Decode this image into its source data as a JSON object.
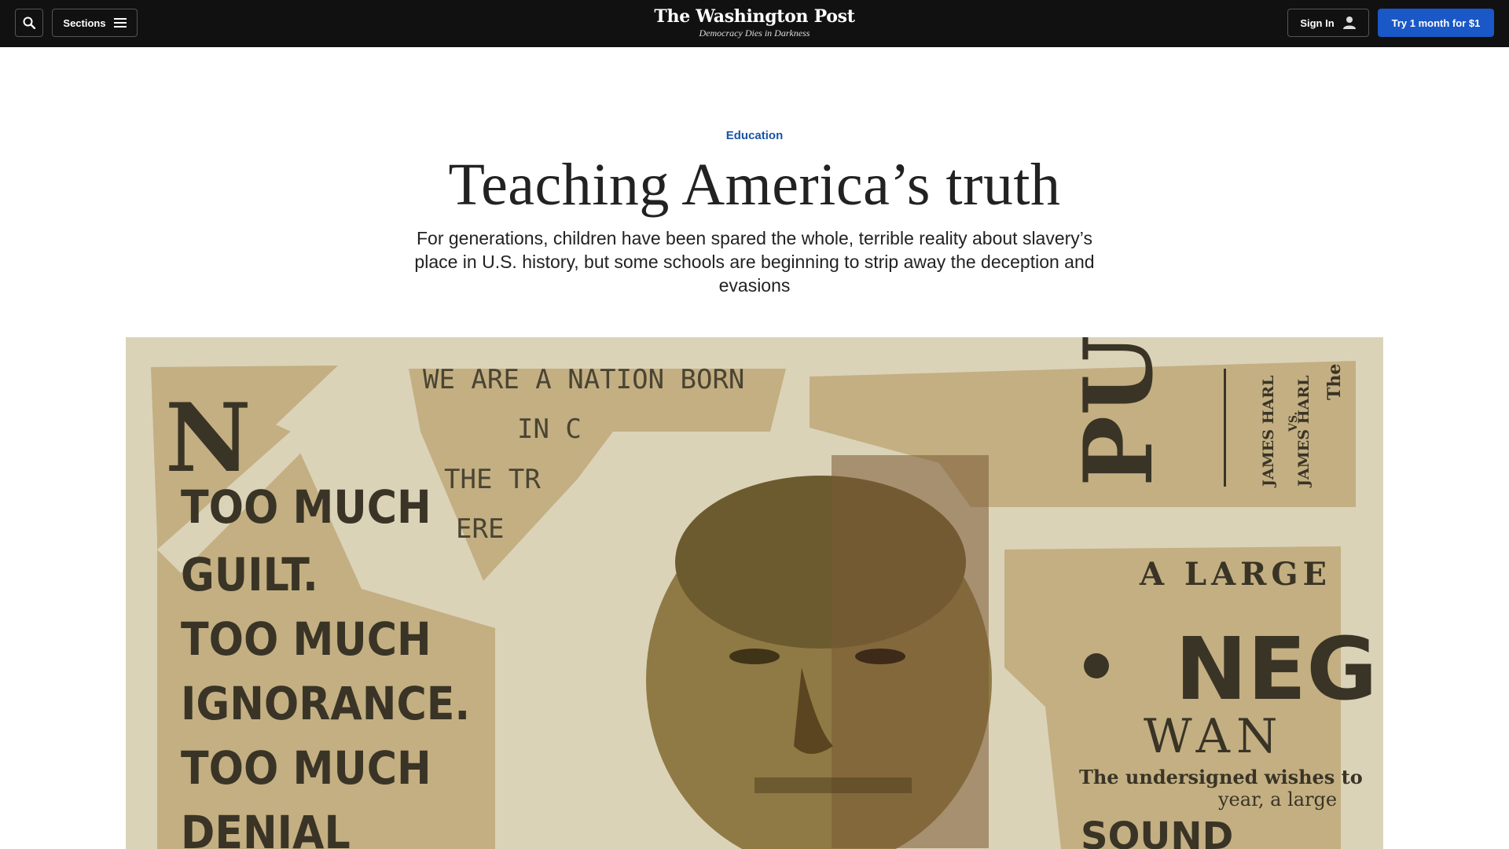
{
  "nav": {
    "search_icon": "search-icon",
    "sections_label": "Sections",
    "menu_icon": "hamburger-icon",
    "logo": "The Washington Post",
    "tagline": "Democracy Dies in Darkness",
    "signin_label": "Sign In",
    "user_icon": "person-icon",
    "trial_label": "Try 1 month for $1"
  },
  "article": {
    "kicker": "Education",
    "headline": "Teaching America’s truth",
    "dek": "For generations, children have been spared the whole, terrible reality about slavery’s place in U.S. history, but some schools are beginning to strip away the deception and evasions"
  },
  "illustration": {
    "left_text": [
      "N",
      "TOO MUCH",
      "GUILT.",
      "TOO MUCH",
      "IGNORANCE.",
      "TOO MUCH",
      "DENIAL"
    ],
    "top_text": [
      "WE ARE A NATION BORN",
      "IN C",
      "THE TR",
      "ERE"
    ],
    "right_top_text": [
      "PU",
      "JAMES HARL",
      "VS.",
      "JAMES HARL",
      "The"
    ],
    "right_text": [
      "A LARGE",
      "NEGR",
      "WAN",
      "The undersigned wishes to",
      "year, a large",
      "SOUND"
    ],
    "colors": {
      "background": "#dbd3b8",
      "paper": "#c2ae80",
      "ink": "#3a3426",
      "portrait": "#8f7a45"
    }
  }
}
